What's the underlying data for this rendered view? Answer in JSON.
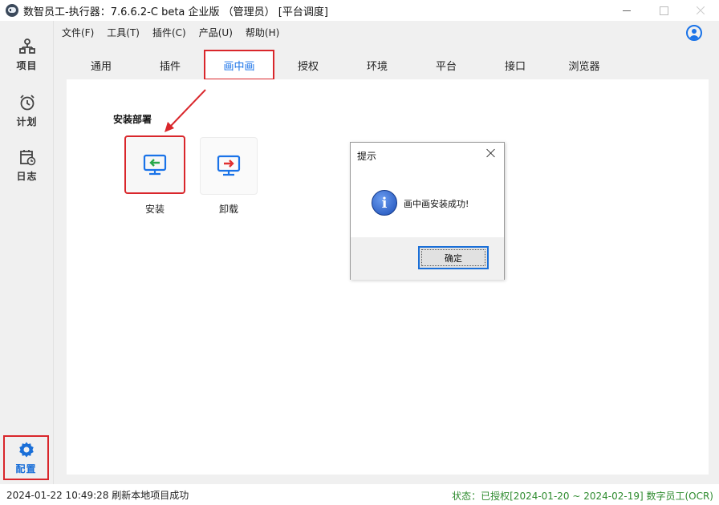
{
  "window": {
    "title": "数智员工-执行器：7.6.6.2-C beta 企业版 （管理员） [平台调度]"
  },
  "leftnav": {
    "items": [
      {
        "label": "项目",
        "icon": "project-tree-icon"
      },
      {
        "label": "计划",
        "icon": "alarm-clock-icon"
      },
      {
        "label": "日志",
        "icon": "log-calendar-icon"
      },
      {
        "label": "配置",
        "icon": "gear-icon"
      }
    ]
  },
  "menubar": {
    "items": [
      "文件(F)",
      "工具(T)",
      "插件(C)",
      "产品(U)",
      "帮助(H)"
    ]
  },
  "tabs": {
    "items": [
      "通用",
      "插件",
      "画中画",
      "授权",
      "环境",
      "平台",
      "接口",
      "浏览器"
    ],
    "active": "画中画"
  },
  "content": {
    "section_title": "安装部署",
    "install_label": "安装",
    "uninstall_label": "卸载"
  },
  "dialog": {
    "title": "提示",
    "message": "画中画安装成功!",
    "ok_label": "确定"
  },
  "statusbar": {
    "left": "2024-01-22 10:49:28 刷新本地项目成功",
    "right": "状态：已授权[2024-01-20 ~ 2024-02-19] 数字员工(OCR)"
  },
  "colors": {
    "accent_blue": "#1a73e8",
    "highlight_red": "#d9262b",
    "status_green": "#2e8b2e"
  }
}
